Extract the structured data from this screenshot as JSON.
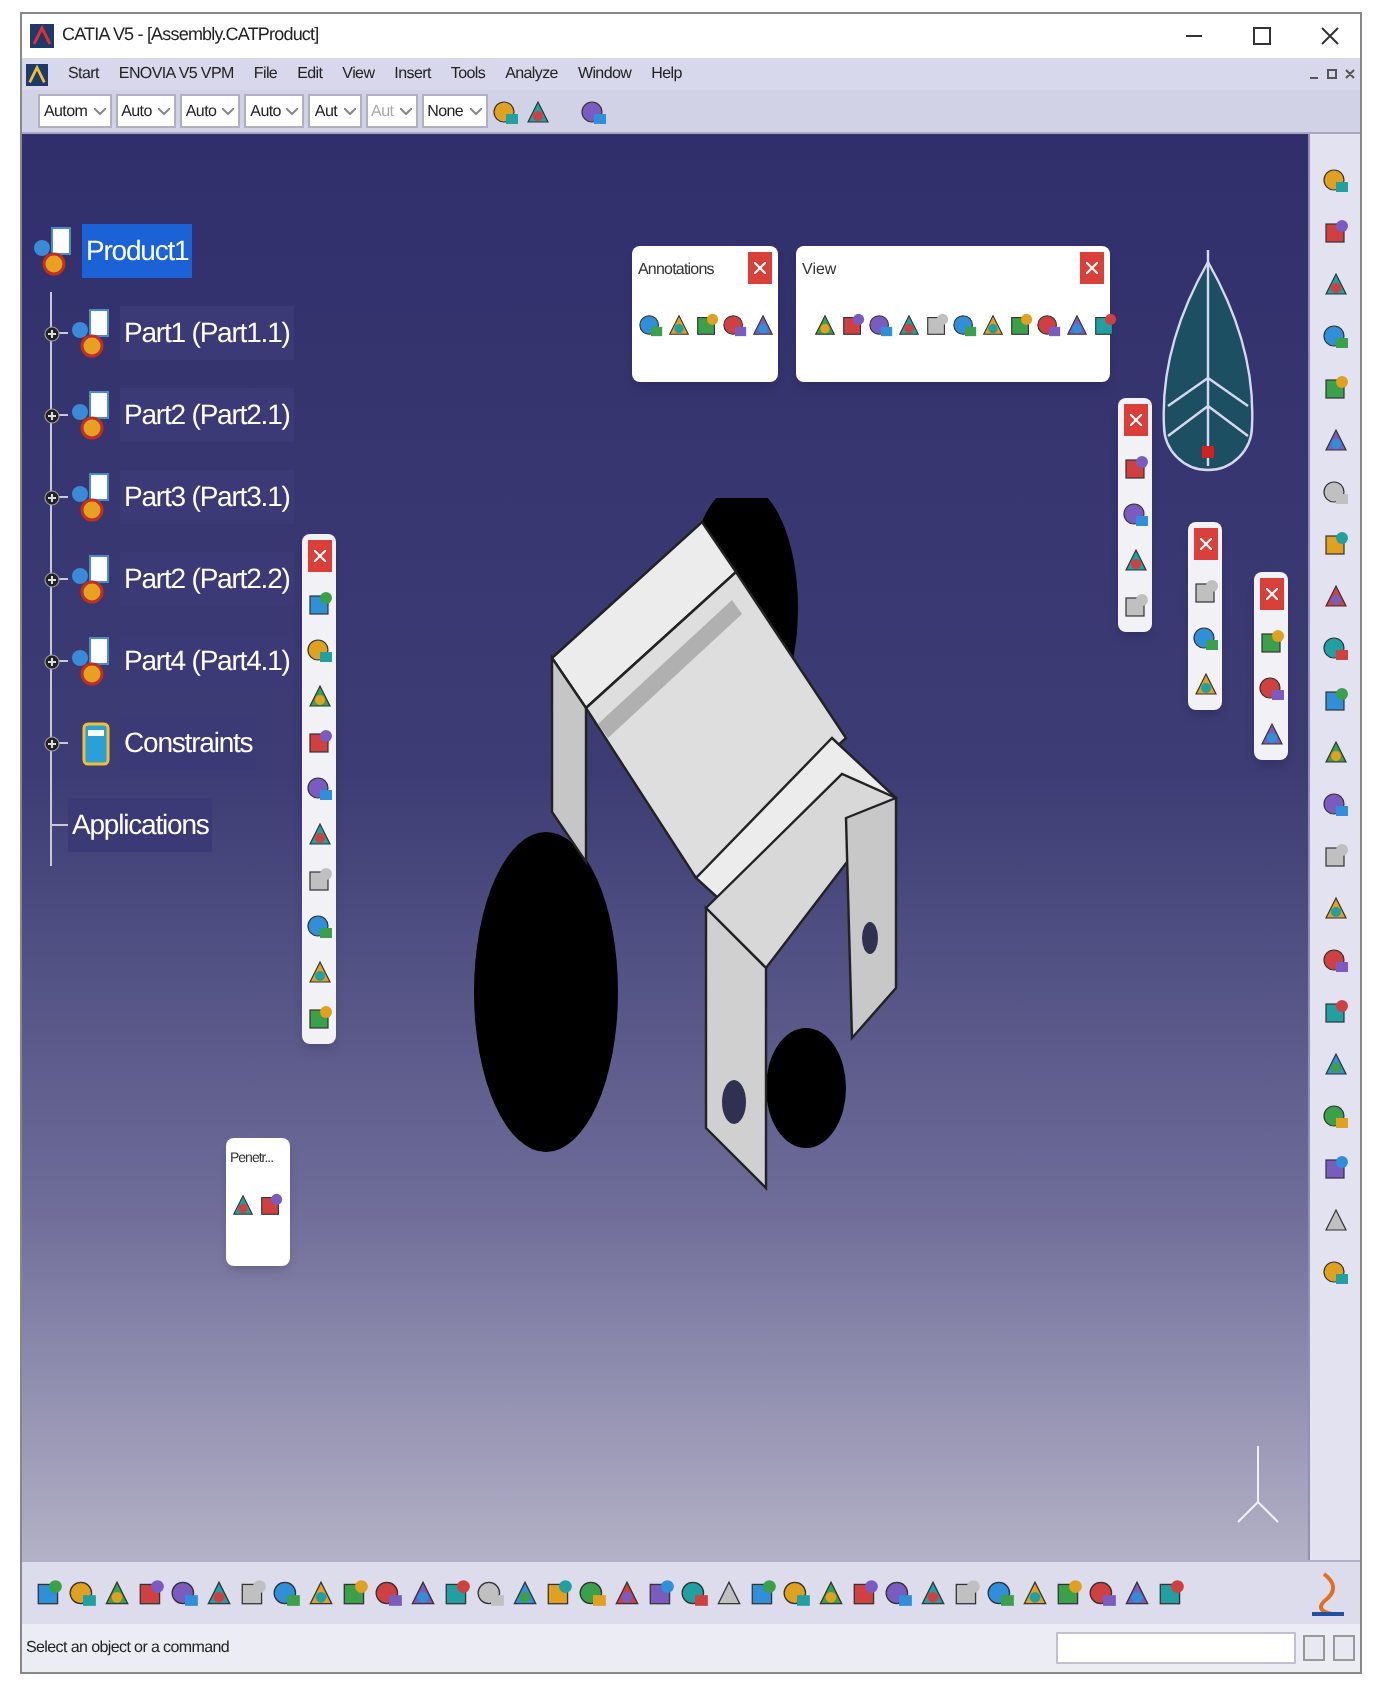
{
  "window": {
    "title": "CATIA V5 - [Assembly.CATProduct]"
  },
  "menu": [
    {
      "label": "Start"
    },
    {
      "label": "ENOVIA V5 VPM"
    },
    {
      "label": "File"
    },
    {
      "label": "Edit"
    },
    {
      "label": "View"
    },
    {
      "label": "Insert"
    },
    {
      "label": "Tools"
    },
    {
      "label": "Analyze"
    },
    {
      "label": "Window"
    },
    {
      "label": "Help"
    }
  ],
  "toolbar": {
    "dropdowns": [
      {
        "value": "Autom",
        "disabled": false
      },
      {
        "value": "Auto",
        "disabled": false
      },
      {
        "value": "Auto",
        "disabled": false
      },
      {
        "value": "Auto",
        "disabled": false
      },
      {
        "value": "Aut",
        "disabled": false
      },
      {
        "value": "Aut",
        "disabled": true
      },
      {
        "value": "None",
        "disabled": false
      }
    ]
  },
  "tree": {
    "items": [
      {
        "label": "Product1",
        "kind": "product",
        "selected": true,
        "children": [
          {
            "label": "Part1 (Part1.1)",
            "kind": "part",
            "selected": false
          },
          {
            "label": "Part2 (Part2.1)",
            "kind": "part",
            "selected": false
          },
          {
            "label": "Part3 (Part3.1)",
            "kind": "part",
            "selected": false
          },
          {
            "label": "Part2 (Part2.2)",
            "kind": "part",
            "selected": false
          },
          {
            "label": "Part4 (Part4.1)",
            "kind": "part",
            "selected": false
          },
          {
            "label": "Constraints",
            "kind": "constraints",
            "selected": false
          },
          {
            "label": "Applications",
            "kind": "applications",
            "selected": false
          }
        ]
      }
    ]
  },
  "floating_toolbars": [
    {
      "title": "Annotations"
    },
    {
      "title": "View"
    },
    {
      "title": "Penetr..."
    }
  ],
  "status_bar": {
    "message": "Select an object or a command"
  }
}
